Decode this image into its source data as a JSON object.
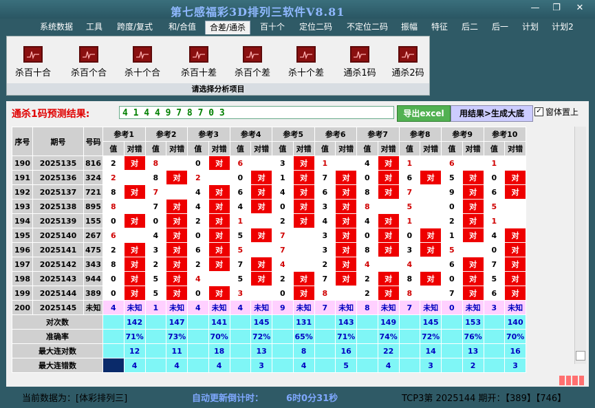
{
  "app": {
    "title": "第七感福彩3D排列三软件V8.81"
  },
  "window_controls": {
    "minimize": "—",
    "restore": "❐",
    "close": "✕"
  },
  "menu": [
    "系统数据",
    "工具",
    "跨度/复式",
    "和/合值",
    "合差/通杀",
    "百十个",
    "定位二码",
    "不定位二码",
    "振幅",
    "特征",
    "后二",
    "后一",
    "计划",
    "计划2"
  ],
  "menu_active": 4,
  "ribbon": {
    "items": [
      "杀百十合",
      "杀百个合",
      "杀十个合",
      "杀百十差",
      "杀百个差",
      "杀十个差",
      "通杀1码",
      "通杀2码"
    ],
    "caption": "请选择分析项目",
    "icon": "chart-icon"
  },
  "prediction": {
    "label": "通杀1码预测结果:",
    "value": "4 1 4 4 9 7 8 7 0 3"
  },
  "buttons": {
    "excel": "导出excel",
    "generate": "用结果>生成大底"
  },
  "checkbox": {
    "label": "窗体置上",
    "checked": "✓"
  },
  "table": {
    "col_seq": "序号",
    "col_period": "期号",
    "col_code": "号码",
    "refs": [
      "参考1",
      "参考2",
      "参考3",
      "参考4",
      "参考5",
      "参考6",
      "参考7",
      "参考8",
      "参考9",
      "参考10"
    ],
    "sub_val": "值",
    "sub_right": "对错",
    "right_mark": "对",
    "unknown": "未知",
    "rows": [
      {
        "seq": "190",
        "period": "2025135",
        "code": "816",
        "cells": [
          [
            "2",
            1,
            0
          ],
          [
            "8",
            0,
            1
          ],
          [
            "0",
            1,
            0
          ],
          [
            "6",
            0,
            1
          ],
          [
            "3",
            1,
            0
          ],
          [
            "1",
            0,
            1
          ],
          [
            "4",
            1,
            0
          ],
          [
            "1",
            0,
            1
          ],
          [
            "6",
            0,
            1
          ],
          [
            "1",
            0,
            1
          ]
        ]
      },
      {
        "seq": "191",
        "period": "2025136",
        "code": "324",
        "cells": [
          [
            "2",
            0,
            1
          ],
          [
            "8",
            1,
            0
          ],
          [
            "2",
            0,
            1
          ],
          [
            "0",
            1,
            0
          ],
          [
            "1",
            1,
            0
          ],
          [
            "7",
            1,
            0
          ],
          [
            "0",
            1,
            0
          ],
          [
            "6",
            1,
            0
          ],
          [
            "5",
            1,
            0
          ],
          [
            "0",
            1,
            0
          ]
        ]
      },
      {
        "seq": "192",
        "period": "2025137",
        "code": "721",
        "cells": [
          [
            "8",
            1,
            0
          ],
          [
            "7",
            0,
            1
          ],
          [
            "4",
            1,
            0
          ],
          [
            "6",
            1,
            0
          ],
          [
            "4",
            1,
            0
          ],
          [
            "6",
            1,
            0
          ],
          [
            "8",
            1,
            0
          ],
          [
            "7",
            0,
            1
          ],
          [
            "9",
            1,
            0
          ],
          [
            "6",
            1,
            0
          ]
        ]
      },
      {
        "seq": "193",
        "period": "2025138",
        "code": "895",
        "cells": [
          [
            "8",
            0,
            1
          ],
          [
            "7",
            1,
            0
          ],
          [
            "4",
            1,
            0
          ],
          [
            "4",
            1,
            0
          ],
          [
            "0",
            1,
            0
          ],
          [
            "3",
            1,
            0
          ],
          [
            "8",
            0,
            1
          ],
          [
            "5",
            0,
            1
          ],
          [
            "0",
            1,
            0
          ],
          [
            "5",
            0,
            1
          ]
        ]
      },
      {
        "seq": "194",
        "period": "2025139",
        "code": "155",
        "cells": [
          [
            "0",
            1,
            0
          ],
          [
            "0",
            1,
            0
          ],
          [
            "2",
            1,
            0
          ],
          [
            "1",
            0,
            1
          ],
          [
            "2",
            1,
            0
          ],
          [
            "4",
            1,
            0
          ],
          [
            "4",
            1,
            0
          ],
          [
            "1",
            0,
            1
          ],
          [
            "2",
            1,
            0
          ],
          [
            "1",
            0,
            1
          ]
        ]
      },
      {
        "seq": "195",
        "period": "2025140",
        "code": "267",
        "cells": [
          [
            "6",
            0,
            1
          ],
          [
            "4",
            1,
            0
          ],
          [
            "0",
            1,
            0
          ],
          [
            "5",
            1,
            0
          ],
          [
            "7",
            0,
            1
          ],
          [
            "3",
            1,
            0
          ],
          [
            "0",
            1,
            0
          ],
          [
            "0",
            1,
            0
          ],
          [
            "1",
            1,
            0
          ],
          [
            "4",
            1,
            0
          ]
        ]
      },
      {
        "seq": "196",
        "period": "2025141",
        "code": "475",
        "cells": [
          [
            "2",
            1,
            0
          ],
          [
            "3",
            1,
            0
          ],
          [
            "6",
            1,
            0
          ],
          [
            "5",
            0,
            1
          ],
          [
            "7",
            0,
            1
          ],
          [
            "3",
            1,
            0
          ],
          [
            "8",
            1,
            0
          ],
          [
            "3",
            1,
            0
          ],
          [
            "5",
            0,
            1
          ],
          [
            "0",
            1,
            0
          ]
        ]
      },
      {
        "seq": "197",
        "period": "2025142",
        "code": "343",
        "cells": [
          [
            "8",
            1,
            0
          ],
          [
            "2",
            1,
            0
          ],
          [
            "2",
            1,
            0
          ],
          [
            "7",
            1,
            0
          ],
          [
            "4",
            0,
            1
          ],
          [
            "2",
            1,
            0
          ],
          [
            "4",
            0,
            1
          ],
          [
            "4",
            0,
            1
          ],
          [
            "6",
            1,
            0
          ],
          [
            "7",
            1,
            0
          ]
        ]
      },
      {
        "seq": "198",
        "period": "2025143",
        "code": "944",
        "cells": [
          [
            "0",
            1,
            0
          ],
          [
            "5",
            1,
            0
          ],
          [
            "4",
            0,
            1
          ],
          [
            "5",
            1,
            0
          ],
          [
            "2",
            1,
            0
          ],
          [
            "7",
            1,
            0
          ],
          [
            "2",
            1,
            0
          ],
          [
            "8",
            1,
            0
          ],
          [
            "0",
            1,
            0
          ],
          [
            "5",
            1,
            0
          ]
        ]
      },
      {
        "seq": "199",
        "period": "2025144",
        "code": "389",
        "cells": [
          [
            "0",
            1,
            0
          ],
          [
            "5",
            1,
            0
          ],
          [
            "0",
            1,
            0
          ],
          [
            "3",
            0,
            1
          ],
          [
            "0",
            1,
            0
          ],
          [
            "8",
            0,
            1
          ],
          [
            "2",
            1,
            0
          ],
          [
            "8",
            0,
            1
          ],
          [
            "7",
            1,
            0
          ],
          [
            "6",
            1,
            0
          ]
        ]
      }
    ],
    "pred_row": {
      "seq": "200",
      "period": "2025145",
      "code": "未知",
      "values": [
        "4",
        "1",
        "4",
        "4",
        "9",
        "7",
        "8",
        "7",
        "0",
        "3"
      ]
    },
    "stats": [
      {
        "label": "对次数",
        "values": [
          "142",
          "147",
          "141",
          "145",
          "131",
          "143",
          "149",
          "145",
          "153",
          "140"
        ]
      },
      {
        "label": "准确率",
        "values": [
          "71%",
          "73%",
          "70%",
          "72%",
          "65%",
          "71%",
          "74%",
          "72%",
          "76%",
          "70%"
        ]
      },
      {
        "label": "最大连对数",
        "values": [
          "12",
          "11",
          "18",
          "13",
          "8",
          "16",
          "22",
          "14",
          "13",
          "16"
        ]
      },
      {
        "label": "最大连错数",
        "values": [
          "4",
          "4",
          "4",
          "3",
          "4",
          "5",
          "4",
          "3",
          "2",
          "3"
        ]
      }
    ]
  },
  "status": {
    "current_data_label": "当前数据为：[体彩排列三]",
    "countdown_label": "自动更新倒计时：",
    "countdown_value": "6时0分31秒",
    "last_draw": "TCP3第 2025144 期开：【389】【746】"
  },
  "colors": {
    "right": "#ee0000",
    "stats": "#7ff6f6",
    "pred": "#ffd0ff",
    "bg": "#2f5a66"
  }
}
